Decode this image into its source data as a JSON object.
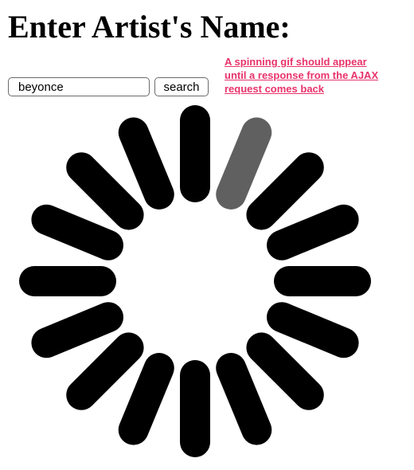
{
  "page": {
    "heading": "Enter Artist's Name:"
  },
  "search": {
    "value": "beyonce",
    "button_label": "search"
  },
  "annotation": {
    "text": "A spinning gif should appear until a response from the AJAX request comes back",
    "color": "#e8336b"
  },
  "spinner": {
    "bar_color": "#000000",
    "highlight_color": "#606060",
    "bar_count": 16,
    "highlighted_index": 1
  }
}
